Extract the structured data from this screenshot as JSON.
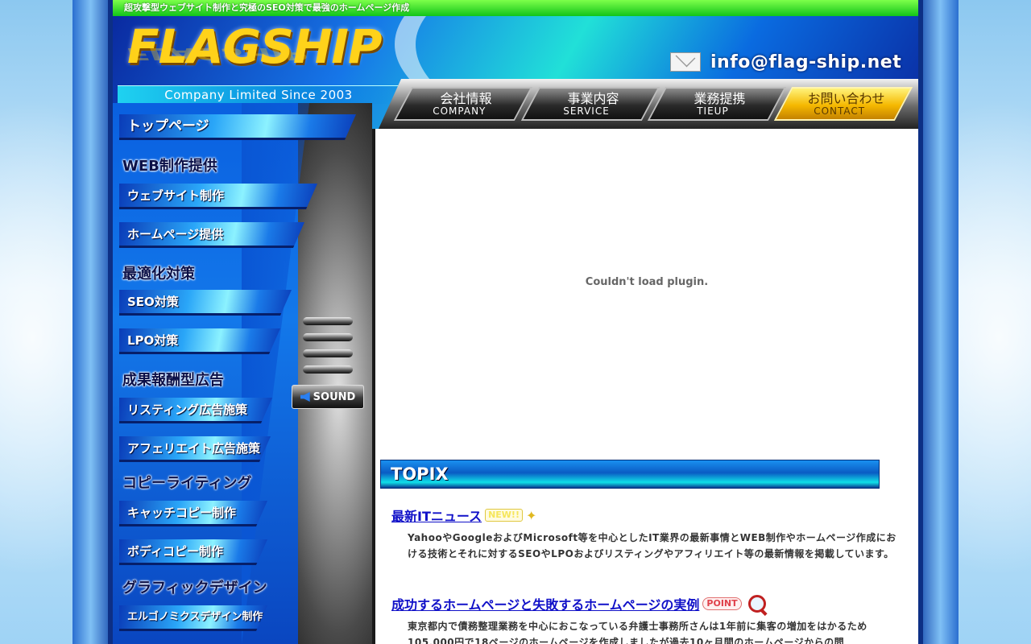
{
  "tagline": "超攻撃型ウェブサイト制作と究極のSEO対策で最強のホームページ作成",
  "logo": {
    "text": "FLAGSHIP",
    "since": "Company Limited Since 2003"
  },
  "header": {
    "email": "info@flag-ship.net"
  },
  "nav": [
    {
      "jp": "会社情報",
      "en": "COMPANY"
    },
    {
      "jp": "事業内容",
      "en": "SERVICE"
    },
    {
      "jp": "業務提携",
      "en": "TIEUP"
    },
    {
      "jp": "お問い合わせ",
      "en": "CONTACT"
    }
  ],
  "sidebar": {
    "top": "トップページ",
    "headings": [
      "WEB制作提供",
      "最適化対策",
      "成果報酬型広告",
      "コピーライティング",
      "グラフィックデザイン"
    ],
    "items": [
      "ウェブサイト制作",
      "ホームページ提供",
      "SEO対策",
      "LPO対策",
      "リスティング広告施策",
      "アフェリエイト広告施策",
      "キャッチコピー制作",
      "ボディコピー制作",
      "エルゴノミクスデザイン制作"
    ],
    "sound": "SOUND"
  },
  "main": {
    "plugin_msg": "Couldn't load plugin.",
    "topix": "TOPIX",
    "news": [
      {
        "title": "最新ITニュース",
        "badge": "NEW!!",
        "body": "YahooやGoogleおよびMicrosoft等を中心としたIT業界の最新事情とWEB制作やホームページ作成における技術とそれに対するSEOやLPOおよびリスティングやアフィリエイト等の最新情報を掲載しています。"
      },
      {
        "title": "成功するホームページと失敗するホームページの実例",
        "badge": "POINT",
        "body": "東京都内で債務整理業務を中心におこなっている弁護士事務所さんは1年前に集客の増加をはかるため105,000円で18ページのホームページを作成しましたが過去10ヶ月間のホームページからの問"
      }
    ]
  },
  "colors": {
    "accent_green": "#12c41a",
    "brand_gold": "#ffd21a",
    "link": "#1010c8"
  }
}
